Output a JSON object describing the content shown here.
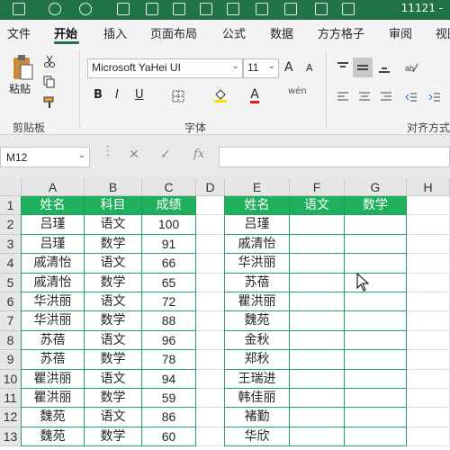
{
  "title_bar": {
    "doc_name": "11121 -"
  },
  "tabs": [
    {
      "label": "文件",
      "active": false
    },
    {
      "label": "开始",
      "active": true
    },
    {
      "label": "插入",
      "active": false
    },
    {
      "label": "页面布局",
      "active": false
    },
    {
      "label": "公式",
      "active": false
    },
    {
      "label": "数据",
      "active": false
    },
    {
      "label": "方方格子",
      "active": false
    },
    {
      "label": "审阅",
      "active": false
    },
    {
      "label": "视图",
      "active": false
    }
  ],
  "ribbon": {
    "clipboard": {
      "paste_label": "粘贴",
      "group_label": "剪贴板"
    },
    "font": {
      "font_name": "Microsoft YaHei UI",
      "font_size": "11",
      "group_label": "字体",
      "bold": "B",
      "italic": "I",
      "underline": "U",
      "grow": "A",
      "shrink": "A",
      "font_color_glyph": "A",
      "phonetic": "wén"
    },
    "alignment": {
      "group_label": "对齐方式"
    }
  },
  "formula_bar": {
    "name_box": "M12",
    "fx": "fx",
    "cancel": "✕",
    "confirm": "✓",
    "formula": ""
  },
  "colors": {
    "accent": "#217346",
    "table_header": "#1fb05e",
    "table_border": "#1fa15f",
    "font_color_underline": "#e02020",
    "fill_color_underline": "#ffe000"
  },
  "sheet": {
    "columns": [
      "A",
      "B",
      "C",
      "D",
      "E",
      "F",
      "G",
      "H"
    ],
    "rows": [
      "1",
      "2",
      "3",
      "4",
      "5",
      "6",
      "7",
      "8",
      "9",
      "10",
      "11",
      "12",
      "13"
    ],
    "left_table": {
      "headers": [
        "姓名",
        "科目",
        "成绩"
      ],
      "rows": [
        [
          "吕瑾",
          "语文",
          "100"
        ],
        [
          "吕瑾",
          "数学",
          "91"
        ],
        [
          "戚清怡",
          "语文",
          "66"
        ],
        [
          "戚清怡",
          "数学",
          "65"
        ],
        [
          "华洪丽",
          "语文",
          "72"
        ],
        [
          "华洪丽",
          "数学",
          "88"
        ],
        [
          "苏蓓",
          "语文",
          "96"
        ],
        [
          "苏蓓",
          "数学",
          "78"
        ],
        [
          "瞿洪丽",
          "语文",
          "94"
        ],
        [
          "瞿洪丽",
          "数学",
          "59"
        ],
        [
          "魏苑",
          "语文",
          "86"
        ],
        [
          "魏苑",
          "数学",
          "60"
        ]
      ]
    },
    "right_table": {
      "headers": [
        "姓名",
        "语文",
        "数学"
      ],
      "rows": [
        [
          "吕瑾",
          "",
          ""
        ],
        [
          "戚清怡",
          "",
          ""
        ],
        [
          "华洪丽",
          "",
          ""
        ],
        [
          "苏蓓",
          "",
          ""
        ],
        [
          "瞿洪丽",
          "",
          ""
        ],
        [
          "魏苑",
          "",
          ""
        ],
        [
          "金秋",
          "",
          ""
        ],
        [
          "郑秋",
          "",
          ""
        ],
        [
          "王瑞进",
          "",
          ""
        ],
        [
          "韩佳丽",
          "",
          ""
        ],
        [
          "褚勤",
          "",
          ""
        ],
        [
          "华欣",
          "",
          ""
        ]
      ]
    }
  }
}
